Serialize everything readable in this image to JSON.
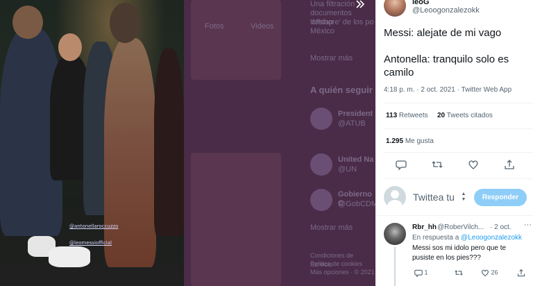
{
  "viewer": {
    "photo_tags": [
      "@antonellaroccuzzo",
      "@leomessiofficial"
    ],
    "background_page": {
      "lines_top": [
        "Una filtración",
        "documentos destap",
        "'offshore' de los po",
        "México"
      ],
      "tabs": [
        "Fotos",
        "Videos"
      ],
      "more_link": "Mostrar más",
      "who_to_follow": "A quién seguir",
      "suggestions": [
        {
          "name": "President",
          "handle": "@ATUB"
        },
        {
          "name": "United Na",
          "handle": "@UN"
        },
        {
          "name": "Gobierno C",
          "handle": "@GobCDMX"
        }
      ],
      "more_link_2": "Mostrar más",
      "footer": [
        "Condiciones de Servicio",
        "Política de cookies",
        "Más opciones · © 2021"
      ]
    },
    "expand_icon": "expand-icon"
  },
  "tweet": {
    "display_name": "leoG",
    "handle": "@Leoogonzalezokk",
    "lines": [
      "Messi: alejate de mi vago",
      "Antonella: tranquilo solo es camilo"
    ],
    "meta": "4:18 p. m. · 2 oct. 2021 · Twitter Web App",
    "retweets_count": "113",
    "retweets_label": "Retweets",
    "quotes_count": "20",
    "quotes_label": "Tweets citados",
    "likes_count": "1.295",
    "likes_label": "Me gusta"
  },
  "compose": {
    "placeholder": "Twittea tu",
    "button": "Responder"
  },
  "reply": {
    "name": "Rbr_hh",
    "handle": "@RoberVilch...",
    "date": "· 2 oct.",
    "more": "···",
    "in_reply_prefix": "En respuesta a",
    "in_reply_handle": "@Leoogonzalezokk",
    "text": "Messi sos mi idolo pero que te pusiste en los pies???",
    "replies": "1",
    "likes": "26"
  },
  "colors": {
    "accent": "#1d9bf0",
    "reply_button": "#8ecdf8",
    "muted": "#536471"
  }
}
